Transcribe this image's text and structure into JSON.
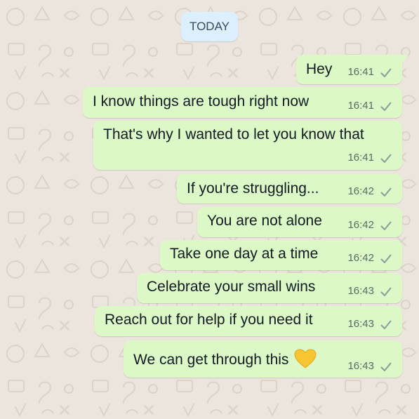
{
  "conversation": {
    "date_label": "TODAY",
    "messages": [
      {
        "text": "Hey",
        "time": "16:41",
        "status_icon": "single-check-icon"
      },
      {
        "text": "I know things are tough right now",
        "time": "16:41",
        "status_icon": "single-check-icon"
      },
      {
        "text": "That's why I wanted to let you know that",
        "time": "16:41",
        "status_icon": "single-check-icon"
      },
      {
        "text": "If you're struggling...",
        "time": "16:42",
        "status_icon": "single-check-icon"
      },
      {
        "text": "You are not alone",
        "time": "16:42",
        "status_icon": "single-check-icon"
      },
      {
        "text": "Take one day at a time",
        "time": "16:42",
        "status_icon": "single-check-icon"
      },
      {
        "text": "Celebrate your small wins",
        "time": "16:43",
        "status_icon": "single-check-icon"
      },
      {
        "text": "Reach out for help if you need it",
        "time": "16:43",
        "status_icon": "single-check-icon"
      },
      {
        "text": "We can get through this",
        "time": "16:43",
        "status_icon": "single-check-icon",
        "emoji": "yellow-heart-icon"
      }
    ]
  },
  "colors": {
    "wallpaper": "#ece5dd",
    "outgoing_bubble": "#dcf8c6",
    "date_chip": "#dcefff",
    "check_mark": "#8c9c95"
  }
}
